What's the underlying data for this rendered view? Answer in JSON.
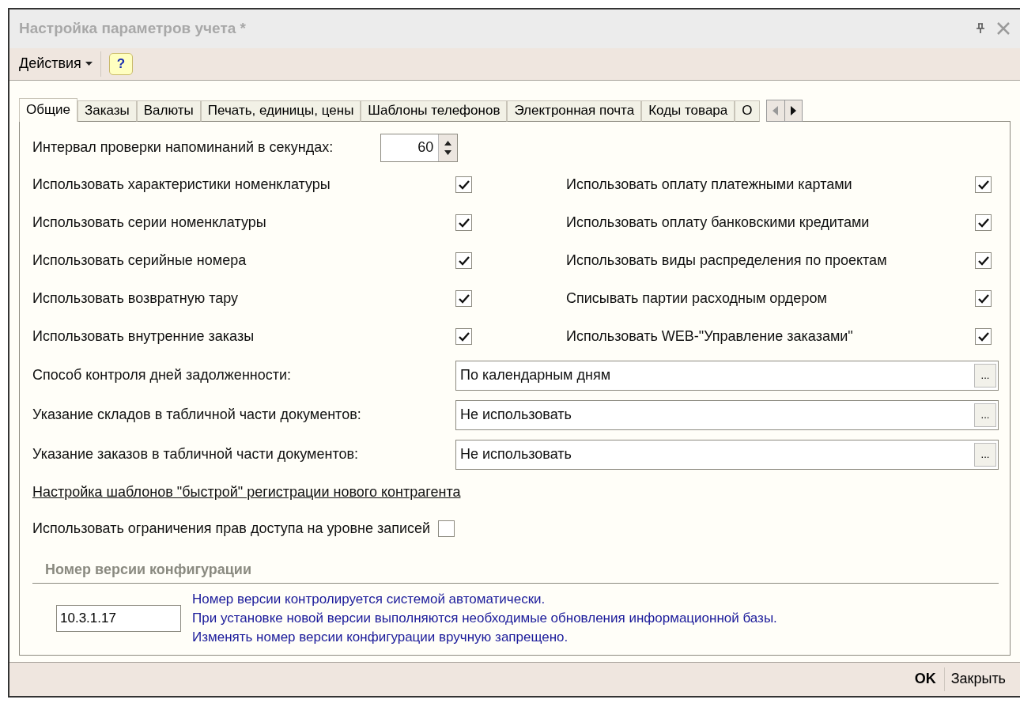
{
  "window": {
    "title": "Настройка параметров учета *"
  },
  "toolbar": {
    "actions_menu": "Действия",
    "help": "?"
  },
  "tabs": [
    {
      "label": "Общие",
      "selected": true
    },
    {
      "label": "Заказы",
      "selected": false
    },
    {
      "label": "Валюты",
      "selected": false
    },
    {
      "label": "Печать, единицы, цены",
      "selected": false
    },
    {
      "label": "Шаблоны телефонов",
      "selected": false
    },
    {
      "label": "Электронная почта",
      "selected": false
    },
    {
      "label": "Коды товара",
      "selected": false
    },
    {
      "label": "О",
      "selected": false
    }
  ],
  "interval": {
    "label": "Интервал проверки напоминаний в секундах:",
    "value": "60"
  },
  "left_options": [
    {
      "label": "Использовать характеристики номенклатуры",
      "checked": true
    },
    {
      "label": "Использовать серии номенклатуры",
      "checked": true
    },
    {
      "label": "Использовать серийные номера",
      "checked": true
    },
    {
      "label": "Использовать возвратную тару",
      "checked": true
    },
    {
      "label": "Использовать внутренние заказы",
      "checked": true
    }
  ],
  "right_options": [
    {
      "label": "Использовать оплату платежными картами",
      "checked": true
    },
    {
      "label": "Использовать оплату банковскими кредитами",
      "checked": true
    },
    {
      "label": "Использовать виды распределения по проектам",
      "checked": true
    },
    {
      "label": "Списывать партии расходным ордером",
      "checked": true
    },
    {
      "label": "Использовать WEB-\"Управление заказами\"",
      "checked": true
    }
  ],
  "selects": [
    {
      "label": "Способ контроля дней задолженности:",
      "value": "По календарным дням",
      "button": "..."
    },
    {
      "label": "Указание складов в табличной части документов:",
      "value": "Не использовать",
      "button": "..."
    },
    {
      "label": "Указание заказов в табличной части документов:",
      "value": "Не использовать",
      "button": "..."
    }
  ],
  "link": "Настройка шаблонов \"быстрой\" регистрации нового контрагента",
  "access_restriction": {
    "label": "Использовать ограничения прав доступа на уровне записей",
    "checked": false
  },
  "version": {
    "heading": "Номер версии конфигурации",
    "value": "10.3.1.17",
    "notes": [
      "Номер версии контролируется системой автоматически.",
      "При установке новой версии выполняются необходимые обновления информационной базы.",
      "Изменять номер версии конфигурации вручную запрещено."
    ]
  },
  "buttons": {
    "ok": "OK",
    "close": "Закрыть"
  }
}
